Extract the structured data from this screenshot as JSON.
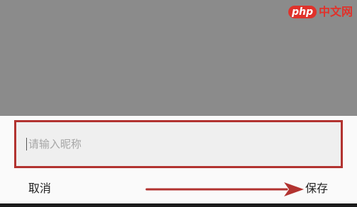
{
  "watermark": {
    "brand_latin": "php",
    "brand_cn": "中文网"
  },
  "dialog": {
    "nickname_input": {
      "placeholder": "请输入昵称",
      "value": ""
    },
    "cancel_label": "取消",
    "save_label": "保存"
  },
  "colors": {
    "highlight": "#b23330",
    "overlay": "#8b8b8b",
    "dialog_bg": "#fafafa",
    "input_bg": "#efefef",
    "watermark": "#e0322b"
  }
}
